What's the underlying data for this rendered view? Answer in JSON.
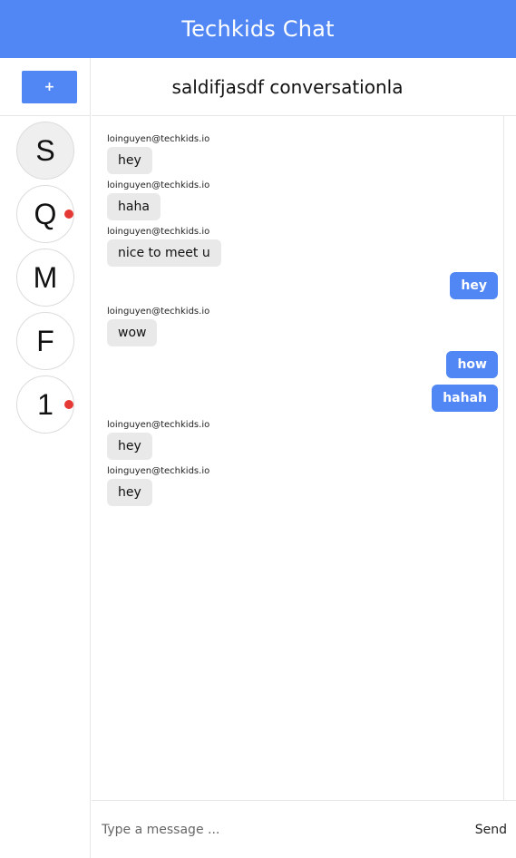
{
  "app": {
    "title": "Techkids Chat"
  },
  "sidebar": {
    "new_button_label": "+",
    "conversations": [
      {
        "letter": "S",
        "active": true,
        "unread": false
      },
      {
        "letter": "Q",
        "active": false,
        "unread": true
      },
      {
        "letter": "M",
        "active": false,
        "unread": false
      },
      {
        "letter": "F",
        "active": false,
        "unread": false
      },
      {
        "letter": "1",
        "active": false,
        "unread": true
      }
    ]
  },
  "conversation": {
    "title": "saldifjasdf conversationla"
  },
  "messages": [
    {
      "sender": "loinguyen@techkids.io",
      "text": "hey",
      "mine": false
    },
    {
      "sender": "loinguyen@techkids.io",
      "text": "haha",
      "mine": false
    },
    {
      "sender": "loinguyen@techkids.io",
      "text": "nice to meet u",
      "mine": false
    },
    {
      "sender": "",
      "text": "hey",
      "mine": true
    },
    {
      "sender": "loinguyen@techkids.io",
      "text": "wow",
      "mine": false
    },
    {
      "sender": "",
      "text": "how",
      "mine": true
    },
    {
      "sender": "",
      "text": "hahah",
      "mine": true
    },
    {
      "sender": "loinguyen@techkids.io",
      "text": "hey",
      "mine": false
    },
    {
      "sender": "loinguyen@techkids.io",
      "text": "hey",
      "mine": false
    }
  ],
  "composer": {
    "placeholder": "Type a message ...",
    "send_label": "Send"
  },
  "colors": {
    "accent": "#5186f5",
    "unread": "#e53935",
    "their_bubble": "#e9e9e9"
  }
}
